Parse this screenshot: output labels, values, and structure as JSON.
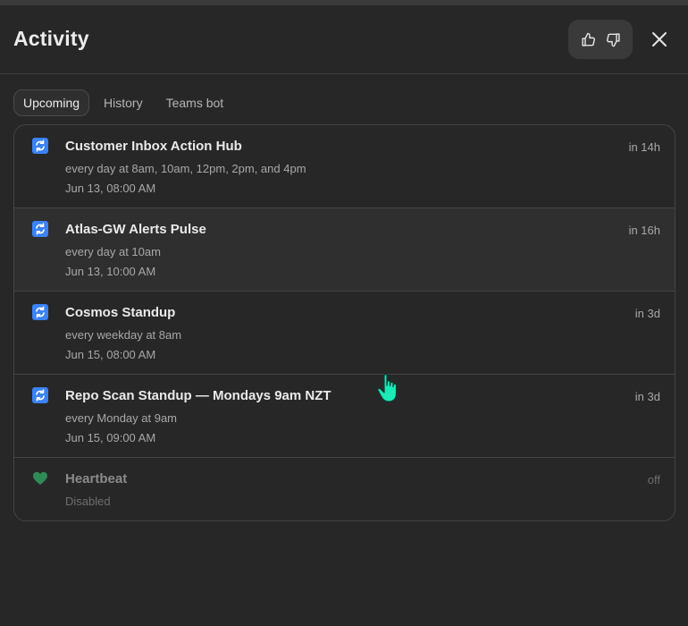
{
  "panel": {
    "title": "Activity",
    "feedback": {
      "thumbs_up_icon": "thumbs-up-icon",
      "thumbs_down_icon": "thumbs-down-icon"
    },
    "close_icon": "close-icon"
  },
  "tabs": [
    {
      "label": "Upcoming",
      "active": true
    },
    {
      "label": "History",
      "active": false
    },
    {
      "label": "Teams bot",
      "active": false
    }
  ],
  "items": [
    {
      "icon": "refresh-icon",
      "title": "Customer Inbox Action Hub",
      "schedule": "every day at 8am, 10am, 12pm, 2pm, and 4pm",
      "next": "Jun 13, 08:00 AM",
      "when": "in 14h"
    },
    {
      "icon": "refresh-icon",
      "title": "Atlas-GW Alerts Pulse",
      "schedule": "every day at 10am",
      "next": "Jun 13, 10:00 AM",
      "when": "in 16h"
    },
    {
      "icon": "refresh-icon",
      "title": "Cosmos Standup",
      "schedule": "every weekday at 8am",
      "next": "Jun 15, 08:00 AM",
      "when": "in 3d"
    },
    {
      "icon": "refresh-icon",
      "title": "Repo Scan Standup — Mondays 9am NZT",
      "schedule": "every Monday at 9am",
      "next": "Jun 15, 09:00 AM",
      "when": "in 3d"
    },
    {
      "icon": "green-heart-icon",
      "title": "Heartbeat",
      "schedule": "Disabled",
      "when": "off"
    }
  ],
  "colors": {
    "background": "#272727",
    "refresh_icon": "#3b82f6",
    "heart": "#2f8a55",
    "cursor": "#1de9b6"
  }
}
